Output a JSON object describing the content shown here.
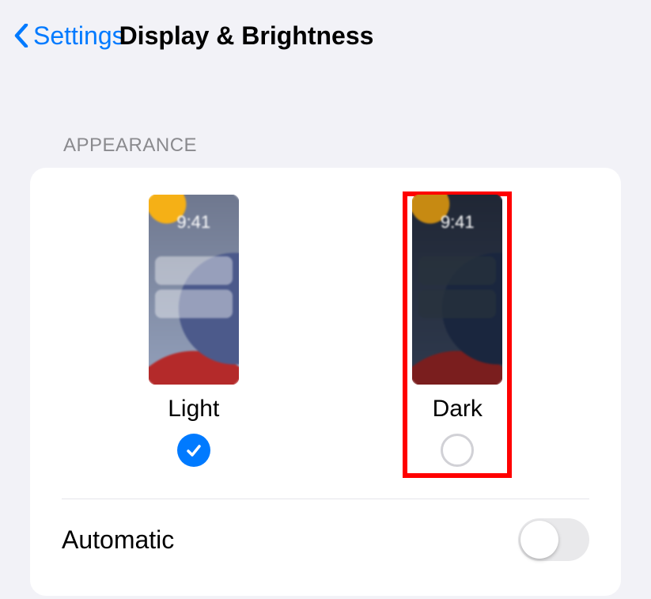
{
  "nav": {
    "back_label": "Settings",
    "title": "Display & Brightness"
  },
  "section": {
    "appearance_header": "APPEARANCE",
    "automatic_label": "Automatic"
  },
  "options": {
    "light": {
      "label": "Light",
      "time": "9:41",
      "selected": true
    },
    "dark": {
      "label": "Dark",
      "time": "9:41",
      "selected": false
    }
  },
  "toggle": {
    "automatic_on": false
  },
  "highlight": {
    "target": "dark",
    "color": "#ff0000"
  }
}
